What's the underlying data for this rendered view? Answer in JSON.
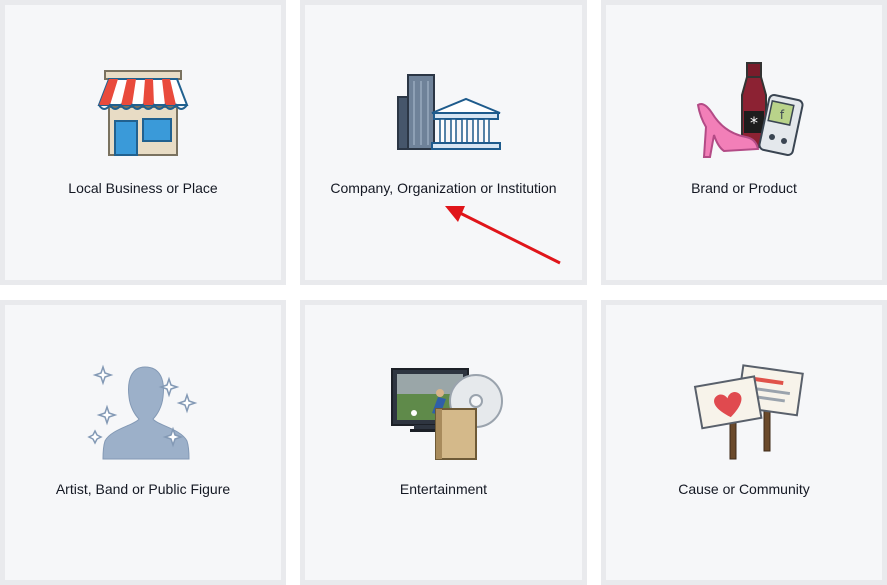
{
  "categories": [
    {
      "label": "Local Business or Place",
      "icon": "storefront-icon"
    },
    {
      "label": "Company, Organization or Institution",
      "icon": "buildings-icon"
    },
    {
      "label": "Brand or Product",
      "icon": "products-icon"
    },
    {
      "label": "Artist, Band or Public Figure",
      "icon": "silhouette-icon"
    },
    {
      "label": "Entertainment",
      "icon": "media-icon"
    },
    {
      "label": "Cause or Community",
      "icon": "signs-icon"
    }
  ],
  "colors": {
    "tile_border": "#e9eaed",
    "tile_bg": "#f6f7f9",
    "text": "#141823",
    "annotation_arrow": "#e0151a"
  }
}
